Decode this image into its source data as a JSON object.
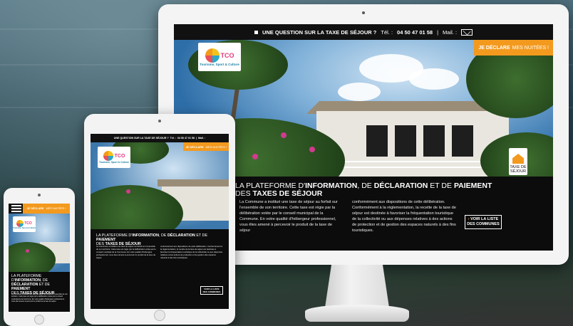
{
  "site": {
    "question_label": "UNE QUESTION SUR LA TAXE DE SÉJOUR ?",
    "phone_label": "Tél. :",
    "phone_number": "04 50 47 01 58",
    "separator": "|",
    "mail_label": "Mail. :",
    "declare_main": "JE DÉCLARE",
    "declare_sub": "MES NUITÉES !",
    "logo_text": "TCO",
    "logo_tagline": "Tourisme, Sport & Culture",
    "badge_line1": "TAXE DE",
    "badge_line2": "SÉJOUR",
    "title_part1": "LA PLATEFORME D'",
    "title_part2": "INFORMATION",
    "title_part3": ", DE ",
    "title_part4": "DÉCLARATION",
    "title_part5": " ET DE ",
    "title_part6": "PAIEMENT",
    "title_part7": "DES ",
    "title_part8": "TAXES DE SÉJOUR",
    "paragraph_left": "La Commune a institué une taxe de séjour au forfait sur l'ensemble de son territoire. Cette taxe est régie par la délibération votée par le conseil municipal de la Commune. En votre qualité d'hébergeur professionnel, vous êtes amené à percevoir le produit de la taxe de séjour",
    "paragraph_right": "conformément aux dispositions de cette délibération. Conformément à la réglementation, la recette de la taxe de séjour est destinée à favoriser la fréquentation touristique de la collectivité ou aux dépenses relatives à des actions de protection et de gestion des espaces naturels à des fins touristiques.",
    "list_button_line1": "VOIR LA LISTE",
    "list_button_line2": "DES COMMUNES",
    "list_button_prefix": "›"
  },
  "colors": {
    "accent_orange": "#f39a1e",
    "logo_pink": "#e5367a",
    "logo_blue": "#1b7fa5",
    "bar_black": "#111111"
  },
  "icons": [
    "mail-icon",
    "menu-icon",
    "house-icon"
  ]
}
